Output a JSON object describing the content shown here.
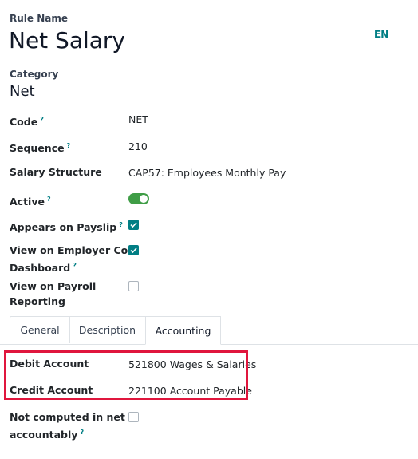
{
  "rule_name_label": "Rule Name",
  "rule_name": "Net Salary",
  "language": "EN",
  "category_label": "Category",
  "category_value": "Net",
  "help_mark": "?",
  "fields": {
    "code": {
      "label": "Code",
      "value": "NET"
    },
    "sequence": {
      "label": "Sequence",
      "value": "210"
    },
    "salary_structure": {
      "label": "Salary Structure",
      "value": "CAP57: Employees Monthly Pay"
    },
    "active": {
      "label": "Active",
      "on": true
    },
    "appears_on_payslip": {
      "label": "Appears on Payslip",
      "checked": true
    },
    "view_employer_cost": {
      "label_line1": "View on Employer Cost",
      "label_line2": "Dashboard",
      "checked": true
    },
    "view_payroll_reporting": {
      "label_line1": "View on Payroll",
      "label_line2": "Reporting",
      "checked": false
    }
  },
  "tabs": [
    {
      "label": "General",
      "active": false
    },
    {
      "label": "Description",
      "active": false
    },
    {
      "label": "Accounting",
      "active": true
    }
  ],
  "accounting": {
    "debit_label": "Debit Account",
    "debit_value": "521800 Wages & Salaries",
    "credit_label": "Credit Account",
    "credit_value": "221100 Account Payable",
    "not_computed_line1": "Not computed in net",
    "not_computed_line2": "accountably",
    "not_computed_checked": false
  },
  "colors": {
    "accent": "#017e84",
    "toggle_on": "#3f9d46",
    "highlight": "#e0163d"
  },
  "icons": {
    "checkmark": "check-icon",
    "help": "help-tooltip-icon"
  }
}
